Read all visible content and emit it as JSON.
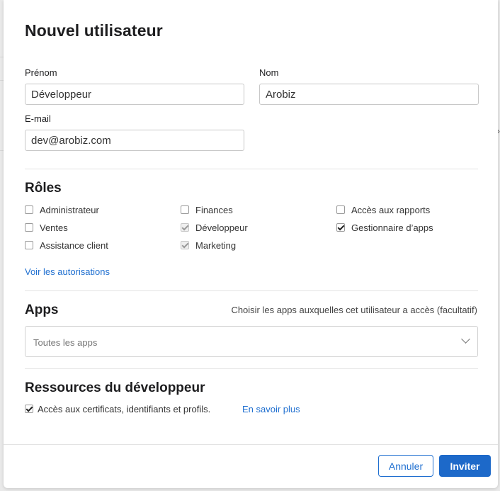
{
  "dialog": {
    "title": "Nouvel utilisateur"
  },
  "form": {
    "first_name": {
      "label": "Prénom",
      "value": "Développeur"
    },
    "last_name": {
      "label": "Nom",
      "value": "Arobiz"
    },
    "email": {
      "label": "E-mail",
      "value": "dev@arobiz.com"
    }
  },
  "roles": {
    "title": "Rôles",
    "items": [
      {
        "label": "Administrateur",
        "checked": false,
        "disabled": false
      },
      {
        "label": "Ventes",
        "checked": false,
        "disabled": false
      },
      {
        "label": "Assistance client",
        "checked": false,
        "disabled": false
      },
      {
        "label": "Finances",
        "checked": false,
        "disabled": false
      },
      {
        "label": "Développeur",
        "checked": true,
        "disabled": true
      },
      {
        "label": "Marketing",
        "checked": true,
        "disabled": true
      },
      {
        "label": "Accès aux rapports",
        "checked": false,
        "disabled": false
      },
      {
        "label": "Gestionnaire d’apps",
        "checked": true,
        "disabled": false
      }
    ],
    "permissions_link": "Voir les autorisations"
  },
  "apps": {
    "title": "Apps",
    "hint": "Choisir les apps auxquelles cet utilisateur a accès (facultatif)",
    "selected": "Toutes les apps"
  },
  "resources": {
    "title": "Ressources du développeur",
    "access_label": "Accès aux certificats, identifiants et profils.",
    "access_checked": true,
    "learn_more": "En savoir plus"
  },
  "footer": {
    "cancel_label": "Annuler",
    "invite_label": "Inviter"
  },
  "colors": {
    "accent": "#1d69c9",
    "link": "#1f6fd0"
  }
}
